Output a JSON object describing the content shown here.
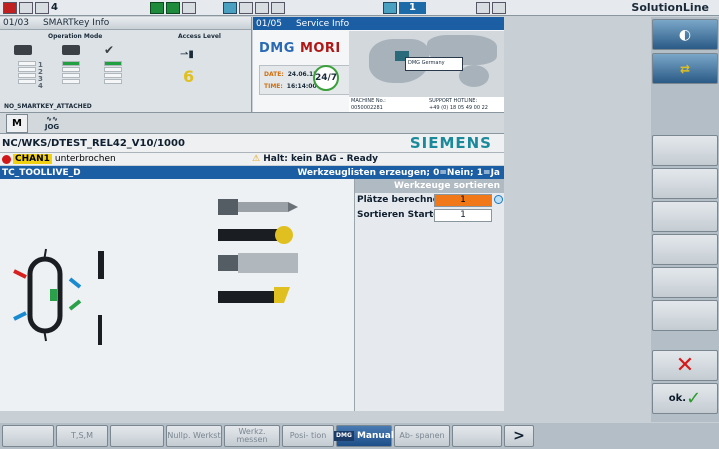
{
  "topbar": {
    "counter": "4",
    "channel_number": "1",
    "brand": "SolutionLine"
  },
  "smartkey": {
    "index": "01/03",
    "title": "SMARTkey Info",
    "operation_mode_label": "Operation Mode",
    "access_level_label": "Access Level",
    "access_level_value": "6",
    "mode_numbers": [
      "1",
      "2",
      "3",
      "4"
    ],
    "status_text": "NO_SMARTKEY_ATTACHED"
  },
  "service": {
    "index": "01/05",
    "title": "Service Info",
    "logo_left": "DMG",
    "logo_right": "MORI",
    "date_label": "DATE:",
    "date_value": "24.06.13",
    "time_label": "TIME:",
    "time_value": "16:14:00",
    "badge": "24/7",
    "map_tooltip": "DMG Germany",
    "machine_no_label": "MACHINE No.:",
    "machine_no_value": "0050002281",
    "hotline_label": "SUPPORT HOTLINE:",
    "hotline_value": "+49 (0) 18 05 49 00 22"
  },
  "modes": {
    "manual_glyph": "M",
    "jog_label": "JOG"
  },
  "program_path": "NC/WKS/DTEST_REL42_V10/1000",
  "siemens_logo": "SIEMENS",
  "channel": {
    "name": "CHAN1",
    "state": "unterbrochen",
    "halt": "Halt: kein BAG - Ready"
  },
  "cycle": {
    "name": "TC_TOOLLIVE_D",
    "hint": "Werkzeuglisten erzeugen; 0=Nein; 1=Ja"
  },
  "pane": {
    "title": "Werkzeuge sortieren",
    "rows": [
      {
        "label": "Plätze berechnen",
        "value": "1"
      },
      {
        "label": "Sortieren Starten",
        "value": "1"
      }
    ]
  },
  "right_softkeys": {
    "cancel": "✕",
    "ok_label": "ok."
  },
  "bottom_softkeys": [
    {
      "label": "T,S,M"
    },
    {
      "label": "Nullp. Werkst"
    },
    {
      "label": "Werkz. messen"
    },
    {
      "label": "Posi- tion"
    },
    {
      "label": "Manual",
      "tag": "DMG"
    },
    {
      "label": "Ab- spanen"
    }
  ],
  "more_arrow": ">",
  "colors": {
    "accent_blue": "#1c5ea4",
    "alarm_red": "#d01818",
    "channel_yellow": "#f0d010",
    "edit_orange": "#f07818"
  }
}
